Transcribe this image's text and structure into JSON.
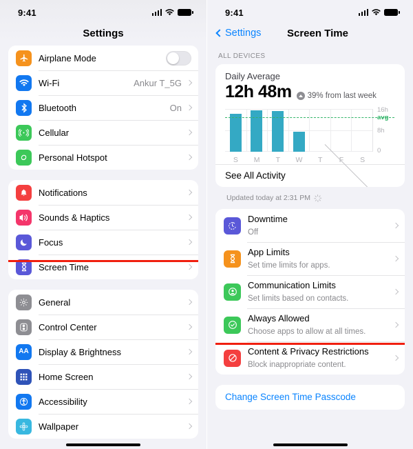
{
  "left": {
    "status": {
      "time": "9:41",
      "signal_icon": "cellular-bars-icon",
      "wifi_icon": "wifi-icon",
      "battery_icon": "battery-icon"
    },
    "nav": {
      "title": "Settings"
    },
    "group1": [
      {
        "label": "Airplane Mode",
        "icon": "airplane-icon",
        "color": "#f5921d",
        "control": "toggle",
        "toggle_on": false
      }
    ],
    "group1b": [
      {
        "label": "Wi-Fi",
        "icon": "wifi-icon",
        "color": "#1278f0",
        "value": "Ankur T_5G"
      },
      {
        "label": "Bluetooth",
        "icon": "bluetooth-icon",
        "color": "#1278f0",
        "value": "On"
      },
      {
        "label": "Cellular",
        "icon": "cellular-antenna-icon",
        "color": "#3cc859",
        "value": ""
      },
      {
        "label": "Personal Hotspot",
        "icon": "hotspot-link-icon",
        "color": "#3cc859",
        "value": ""
      }
    ],
    "group2": [
      {
        "label": "Notifications",
        "icon": "bell-icon",
        "color": "#f43f3f",
        "value": ""
      },
      {
        "label": "Sounds & Haptics",
        "icon": "speaker-icon",
        "color": "#f4356a",
        "value": ""
      },
      {
        "label": "Focus",
        "icon": "moon-icon",
        "color": "#5a58d8",
        "value": ""
      },
      {
        "label": "Screen Time",
        "icon": "hourglass-icon",
        "color": "#5a58d8",
        "value": "",
        "highlighted": true
      }
    ],
    "group3": [
      {
        "label": "General",
        "icon": "gear-icon",
        "color": "#8e8e93",
        "value": ""
      },
      {
        "label": "Control Center",
        "icon": "sliders-icon",
        "color": "#8e8e93",
        "value": ""
      },
      {
        "label": "Display & Brightness",
        "icon": "aa-text-icon",
        "color": "#1278f0",
        "value": "",
        "glyph": "AA"
      },
      {
        "label": "Home Screen",
        "icon": "home-screen-grid-icon",
        "color": "#2f53b8",
        "value": ""
      },
      {
        "label": "Accessibility",
        "icon": "accessibility-person-icon",
        "color": "#1278f0",
        "value": ""
      },
      {
        "label": "Wallpaper",
        "icon": "wallpaper-flower-icon",
        "color": "#38b8e0",
        "value": ""
      }
    ]
  },
  "right": {
    "status": {
      "time": "9:41"
    },
    "nav": {
      "back_label": "Settings",
      "title": "Screen Time"
    },
    "section_header": "ALL DEVICES",
    "summary": {
      "title": "Daily Average",
      "total": "12h 48m",
      "delta": "39% from last week",
      "delta_direction": "up",
      "see_all_label": "See All Activity",
      "updated_text": "Updated today at 2:31 PM"
    },
    "features": [
      {
        "title": "Downtime",
        "subtitle": "Off",
        "icon": "downtime-clock-icon",
        "color": "#5a58d8"
      },
      {
        "title": "App Limits",
        "subtitle": "Set time limits for apps.",
        "icon": "hourglass-icon",
        "color": "#f5921d"
      },
      {
        "title": "Communication Limits",
        "subtitle": "Set limits based on contacts.",
        "icon": "person-circle-icon",
        "color": "#3cc859"
      },
      {
        "title": "Always Allowed",
        "subtitle": "Choose apps to allow at all times.",
        "icon": "check-circle-icon",
        "color": "#3cc859"
      },
      {
        "title": "Content & Privacy Restrictions",
        "subtitle": "Block inappropriate content.",
        "icon": "no-entry-icon",
        "color": "#f43f3f",
        "highlighted": true
      }
    ],
    "passcode_link": "Change Screen Time Passcode"
  },
  "chart_data": {
    "type": "bar",
    "title": "Daily Average",
    "categories": [
      "S",
      "M",
      "T",
      "W",
      "T",
      "F",
      "S"
    ],
    "values": [
      14.2,
      15.4,
      15.2,
      7.6,
      0,
      0,
      0
    ],
    "ylabel": "",
    "xlabel": "",
    "ylim": [
      0,
      16
    ],
    "ytick_labels": [
      "16h",
      "8h",
      "0"
    ],
    "ytick_values": [
      16,
      8,
      0
    ],
    "average_line": {
      "label": "avg",
      "value": 12.8,
      "color": "#33b469",
      "style": "dashed"
    },
    "bar_color": "#34a9c4",
    "grid": true,
    "legend": false
  }
}
